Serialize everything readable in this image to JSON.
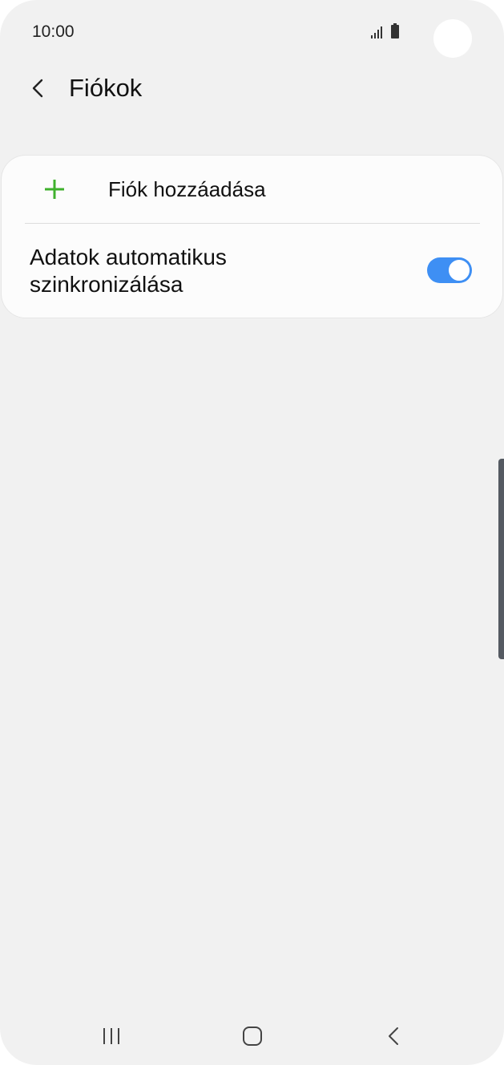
{
  "status_bar": {
    "time": "10:00",
    "icons": [
      "signal-icon",
      "battery-icon"
    ]
  },
  "header": {
    "back_icon": "chevron-left-icon",
    "title": "Fiókok"
  },
  "accounts_card": {
    "add_account": {
      "icon": "plus-icon",
      "label": "Fiók hozzáadása",
      "icon_color": "#3fb12d"
    },
    "auto_sync": {
      "label": "Adatok automatikus szinkronizálása",
      "enabled": true,
      "toggle_color": "#3e8ff4"
    }
  },
  "nav_bar": {
    "buttons": [
      {
        "name": "recent-apps-button",
        "icon": "recents-icon"
      },
      {
        "name": "home-button",
        "icon": "home-icon"
      },
      {
        "name": "back-button",
        "icon": "back-icon"
      }
    ]
  },
  "colors": {
    "background": "#f1f1f1",
    "card": "#fcfcfc",
    "accent_green": "#3fb12d",
    "accent_blue": "#3e8ff4"
  }
}
